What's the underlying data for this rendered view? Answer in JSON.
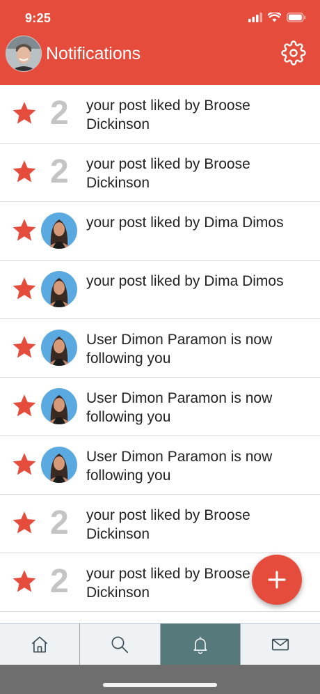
{
  "status_bar": {
    "time": "9:25"
  },
  "header": {
    "title": "Notifications"
  },
  "notifications": [
    {
      "rank": "2",
      "avatar": false,
      "text": "your post liked by Broose Dickinson"
    },
    {
      "rank": "2",
      "avatar": false,
      "text": "your post liked by Broose Dickinson"
    },
    {
      "rank": "",
      "avatar": true,
      "text": "your post liked by Dima Dimos"
    },
    {
      "rank": "",
      "avatar": true,
      "text": "your post liked by Dima Dimos"
    },
    {
      "rank": "",
      "avatar": true,
      "text": "User Dimon Paramon is now following you"
    },
    {
      "rank": "",
      "avatar": true,
      "text": "User Dimon Paramon is now following you"
    },
    {
      "rank": "",
      "avatar": true,
      "text": "User Dimon Paramon is now following you"
    },
    {
      "rank": "2",
      "avatar": false,
      "text": "your post liked by Broose Dickinson"
    },
    {
      "rank": "2",
      "avatar": false,
      "text": "your post liked by Broose Dickinson"
    }
  ],
  "tabs": [
    {
      "icon": "home-icon",
      "active": false
    },
    {
      "icon": "search-icon",
      "active": false
    },
    {
      "icon": "bell-icon",
      "active": true
    },
    {
      "icon": "mail-icon",
      "active": false
    }
  ],
  "colors": {
    "accent": "#e64c3c",
    "active_tab": "#567a7c",
    "tab_bar": "#eef2f4"
  }
}
